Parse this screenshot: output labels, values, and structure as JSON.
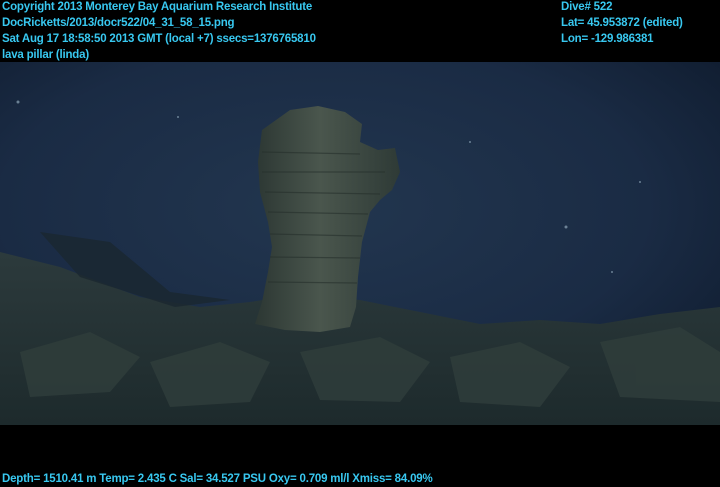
{
  "overlay": {
    "copyright": "Copyright 2013 Monterey Bay Aquarium Research Institute",
    "file_path": "DocRicketts/2013/docr522/04_31_58_15.png",
    "timestamp": "Sat Aug 17 18:58:50 2013 GMT (local +7)  ssecs=1376765810",
    "annotation": "lava pillar (linda)",
    "dive": "Dive# 522",
    "latitude": "Lat= 45.953872 (edited)",
    "longitude": "Lon= -129.986381",
    "telemetry": "Depth= 1510.41 m  Temp= 2.435 C  Sal= 34.527 PSU  Oxy= 0.709 ml/l  Xmiss= 84.09%"
  },
  "colors": {
    "overlay_text": "#38c8f0",
    "water": "#1a2b44",
    "rock": "#3a463f"
  }
}
